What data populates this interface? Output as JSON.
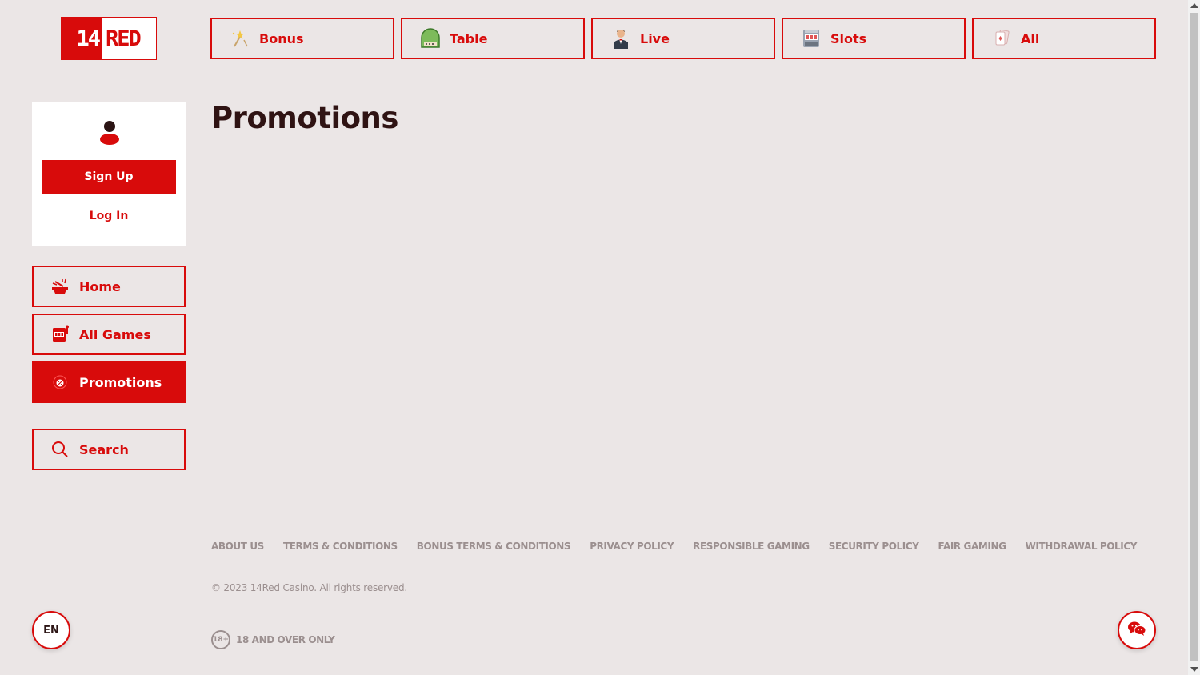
{
  "logo": {
    "number": "14",
    "text": "RED"
  },
  "categories": [
    {
      "label": "Bonus",
      "icon": "sparkle-wand-icon"
    },
    {
      "label": "Table",
      "icon": "roulette-table-icon"
    },
    {
      "label": "Live",
      "icon": "dealer-icon"
    },
    {
      "label": "Slots",
      "icon": "slot-machine-icon"
    },
    {
      "label": "All",
      "icon": "cards-icon"
    }
  ],
  "account": {
    "signup_label": "Sign Up",
    "login_label": "Log In"
  },
  "sidebar": {
    "items": [
      {
        "label": "Home",
        "icon": "home-icon",
        "active": false
      },
      {
        "label": "All Games",
        "icon": "slot-machine-icon",
        "active": false
      },
      {
        "label": "Promotions",
        "icon": "promotion-icon",
        "active": true
      }
    ],
    "search_label": "Search"
  },
  "main": {
    "title": "Promotions"
  },
  "footer": {
    "links": [
      "ABOUT US",
      "TERMS & CONDITIONS",
      "BONUS TERMS & CONDITIONS",
      "PRIVACY POLICY",
      "RESPONSIBLE GAMING",
      "SECURITY POLICY",
      "FAIR GAMING",
      "WITHDRAWAL POLICY"
    ],
    "copyright": "© 2023 14Red Casino. All rights reserved.",
    "age_badge": "18+",
    "age_text": "18 AND OVER ONLY"
  },
  "language": "EN",
  "colors": {
    "accent": "#d80b0b",
    "background": "#ebe6e6",
    "muted": "#9b8f8f",
    "title": "#2f1313"
  }
}
